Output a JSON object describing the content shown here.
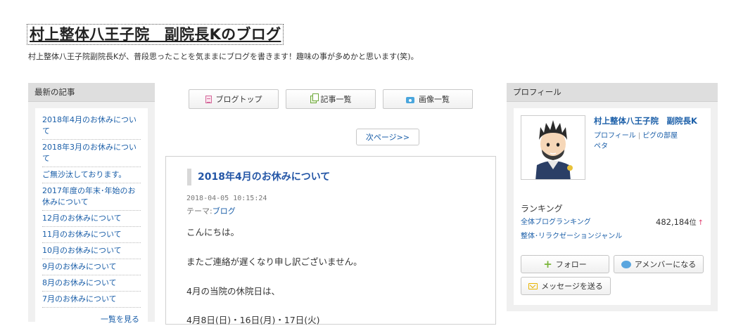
{
  "header": {
    "title": "村上整体八王子院　副院長Kのブログ",
    "description": "村上整体八王子院副院長Kが、普段思ったことを気ままにブログを書きます！趣味の事が多めかと思います(笑)。"
  },
  "recent": {
    "heading": "最新の記事",
    "items": [
      "2018年4月のお休みについて",
      "2018年3月のお休みについて",
      "ご無沙汰しております。",
      "2017年度の年末･年始のお休みについて",
      "12月のお休みについて",
      "11月のお休みについて",
      "10月のお休みについて",
      "9月のお休みについて",
      "8月のお休みについて",
      "7月のお休みについて"
    ],
    "more": "一覧を見る"
  },
  "nav": {
    "blog_top": "ブログトップ",
    "entry_list": "記事一覧",
    "image_list": "画像一覧",
    "next_page": "次ページ>>"
  },
  "article": {
    "title": "2018年4月のお休みについて",
    "date": "2018-04-05 10:15:24",
    "theme_label": "テーマ:",
    "theme": "ブログ",
    "lines": [
      "こんにちは。",
      "またご連絡が遅くなり申し訳ございません。",
      "4月の当院の休院日は、",
      "4月8日(日)・16日(月)・17日(火)"
    ]
  },
  "profile": {
    "heading": "プロフィール",
    "name": "村上整体八王子院　副院長K",
    "link_profile": "プロフィール",
    "link_room": "ピグの部屋",
    "peta": "ペタ",
    "ranking_label": "ランキング",
    "ranking_all": "全体ブログランキング",
    "ranking_genre": "整体･リラクゼーションジャンル",
    "rank_value": "482,184",
    "rank_unit": "位",
    "rank_trend": "↑",
    "follow": "フォロー",
    "amember": "アメンバーになる",
    "message": "メッセージを送る"
  }
}
